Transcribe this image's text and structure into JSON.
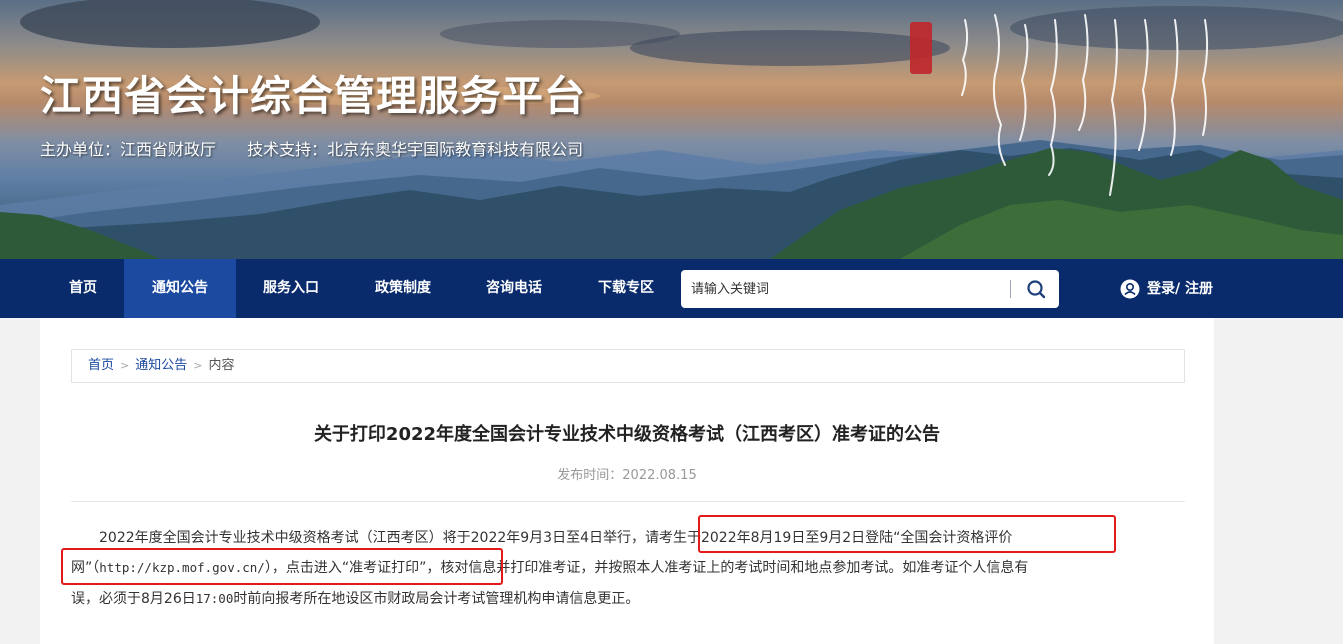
{
  "header": {
    "site_title": "江西省会计综合管理服务平台",
    "sponsor": "主办单位：江西省财政厅",
    "tech_support": "技术支持：北京东奥华宇国际教育科技有限公司"
  },
  "nav": {
    "items": [
      {
        "label": "首页",
        "active": false
      },
      {
        "label": "通知公告",
        "active": true
      },
      {
        "label": "服务入口",
        "active": false
      },
      {
        "label": "政策制度",
        "active": false
      },
      {
        "label": "咨询电话",
        "active": false
      },
      {
        "label": "下载专区",
        "active": false
      }
    ],
    "search_placeholder": "请输入关键词",
    "search_icon": "search-icon",
    "login_label": "登录/ 注册",
    "login_icon": "user-icon"
  },
  "breadcrumb": {
    "home": "首页",
    "section": "通知公告",
    "current": "内容"
  },
  "article": {
    "title": "关于打印2022年度全国会计专业技术中级资格考试（江西考区）准考证的公告",
    "date": "发布时间：2022.08.15",
    "line1_a": "2022年度全国会计专业技术中级资格考试（江西考区）将于2022年9月3日至4日举行，",
    "line1_b": "请考生于2022年8月19日至9月2日登陆“全国会计资格评价",
    "line2_a": "网”（",
    "line2_url": "http://kzp.mof.gov.cn/",
    "line2_b": "），点击进入“准考证打印”",
    "line2_c": "，核对信息并打印准考证，并按照本人准考证上的考试时间和地点参加考试。如准考证个人信息有",
    "line3_a": "误，必须于8月26日",
    "line3_time": "17:00",
    "line3_b": "时前向报考所在地设区市财政局会计考试管理机构申请信息更正。"
  },
  "colors": {
    "nav_bg": "#0a2b6b",
    "nav_active": "#1c4aa0",
    "highlight_box": "#e21a1a",
    "link": "#1c4aa0"
  }
}
